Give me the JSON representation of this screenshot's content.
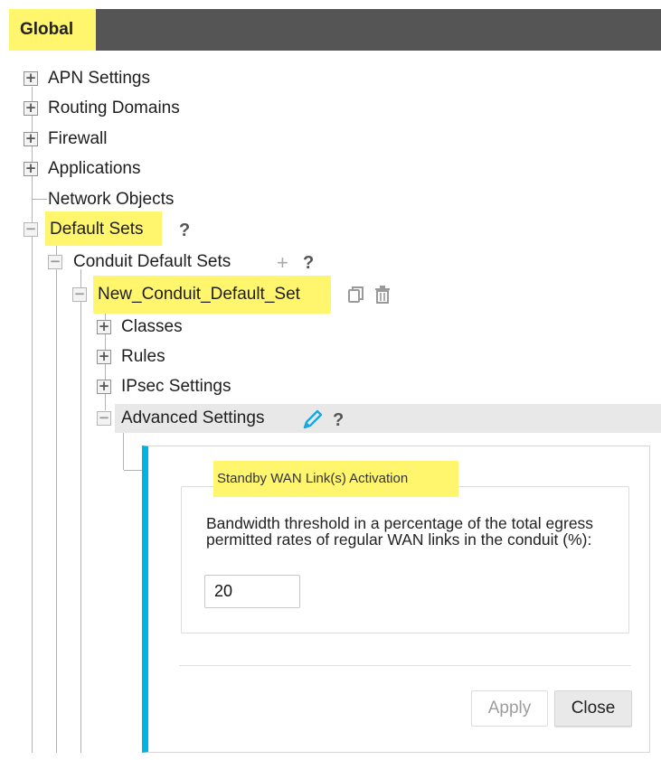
{
  "header": {
    "title": "Global"
  },
  "tree": {
    "apn_settings": "APN Settings",
    "routing_domains": "Routing Domains",
    "firewall": "Firewall",
    "applications": "Applications",
    "network_objects": "Network Objects",
    "default_sets": "Default Sets",
    "conduit_default_sets": "Conduit Default Sets",
    "new_conduit_default_set": "New_Conduit_Default_Set",
    "classes": "Classes",
    "rules": "Rules",
    "ipsec_settings": "IPsec Settings",
    "advanced_settings": "Advanced Settings",
    "help_mark": "?",
    "add_mark": "+",
    "expand_glyph": "+",
    "collapse_glyph": "−"
  },
  "panel": {
    "legend": "Standby WAN Link(s) Activation",
    "field_label": "Bandwidth threshold in a percentage of the total egress permitted rates of regular WAN links in the conduit (%):",
    "field_value": "20",
    "apply_label": "Apply",
    "close_label": "Close"
  },
  "icons": {
    "copy": "copy-icon",
    "trash": "trash-icon",
    "edit": "pencil-icon"
  },
  "colors": {
    "highlight": "#fff66e",
    "header_bg": "#555555",
    "panel_accent": "#00b3e2",
    "edit_icon": "#1aa8de"
  }
}
